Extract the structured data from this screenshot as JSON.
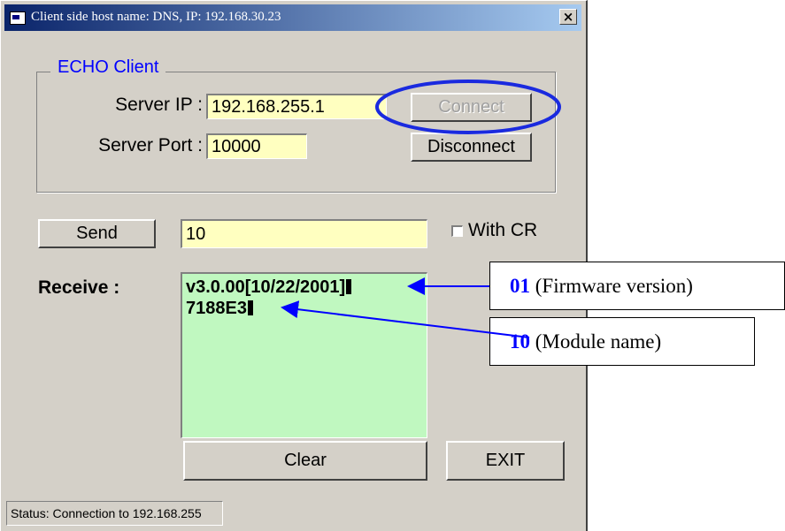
{
  "window": {
    "title": "Client side host name: DNS,   IP: 192.168.30.23",
    "close_label": "×"
  },
  "group": {
    "title": "ECHO  Client"
  },
  "server": {
    "ip_label": "Server IP :",
    "ip_value": "192.168.255.1",
    "port_label": "Server Port :",
    "port_value": "10000"
  },
  "buttons": {
    "connect": "Connect",
    "disconnect": "Disconnect",
    "send": "Send",
    "clear": "Clear",
    "exit": "EXIT"
  },
  "send_field": {
    "value": "10"
  },
  "with_cr": {
    "label": "With CR",
    "checked": false
  },
  "receive": {
    "label": "Receive :",
    "lines": [
      "v3.0.00[10/22/2001]",
      "7188E3"
    ]
  },
  "status": {
    "text": "Status: Connection to 192.168.255"
  },
  "callouts": [
    {
      "code": "01",
      "text": " (Firmware version)"
    },
    {
      "code": "10",
      "text": " (Module name)"
    }
  ],
  "colors": {
    "highlight_ellipse": "#1a2adf",
    "arrow": "#0000ff",
    "field_bg": "#ffffc0",
    "receive_bg": "#c0f8c0"
  }
}
